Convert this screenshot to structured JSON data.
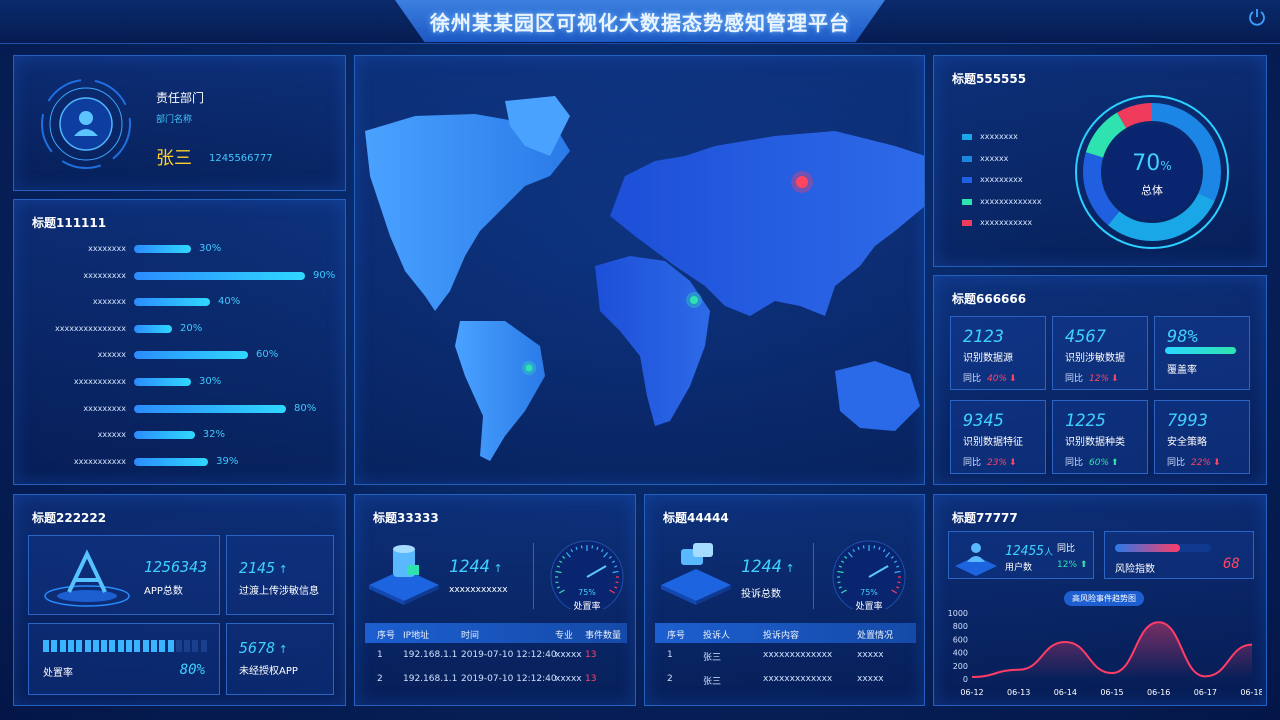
{
  "header": {
    "title": "徐州某某园区可视化大数据态势感知管理平台"
  },
  "user": {
    "dept_label": "责任部门",
    "dept_name": "部门名称",
    "name": "张三",
    "phone": "1245566777"
  },
  "panel1": {
    "title": "标题111111",
    "rows": [
      {
        "label": "xxxxxxxx",
        "value": "30%",
        "pct": 30
      },
      {
        "label": "xxxxxxxxx",
        "value": "90%",
        "pct": 90
      },
      {
        "label": "xxxxxxx",
        "value": "40%",
        "pct": 40
      },
      {
        "label": "xxxxxxxxxxxxxxx",
        "value": "20%",
        "pct": 20
      },
      {
        "label": "xxxxxx",
        "value": "60%",
        "pct": 60
      },
      {
        "label": "xxxxxxxxxxx",
        "value": "30%",
        "pct": 30
      },
      {
        "label": "xxxxxxxxx",
        "value": "80%",
        "pct": 80
      },
      {
        "label": "xxxxxx",
        "value": "32%",
        "pct": 32
      },
      {
        "label": "xxxxxxxxxxx",
        "value": "39%",
        "pct": 39
      }
    ]
  },
  "panel5": {
    "title": "标题555555",
    "legend": [
      {
        "label": "xxxxxxxx",
        "color": "#1aa7e8"
      },
      {
        "label": "xxxxxx",
        "color": "#1a86e0"
      },
      {
        "label": "xxxxxxxxx",
        "color": "#1f5fe0"
      },
      {
        "label": "xxxxxxxxxxxxx",
        "color": "#2ee3b0"
      },
      {
        "label": "xxxxxxxxxxx",
        "color": "#ef3b5c"
      }
    ],
    "donut_value": "70",
    "donut_unit": "%",
    "donut_label": "总体"
  },
  "panel6": {
    "title": "标题666666",
    "stats": [
      {
        "num": "2123",
        "label": "识别数据源",
        "cmp_prefix": "同比",
        "cmp": "40%",
        "dir": "down"
      },
      {
        "num": "4567",
        "label": "识别涉敏数据",
        "cmp_prefix": "同比",
        "cmp": "12%",
        "dir": "down"
      },
      {
        "num": "98%",
        "label": "覆盖率",
        "cmp_prefix": "",
        "cmp": "",
        "dir": "bar"
      },
      {
        "num": "9345",
        "label": "识别数据特征",
        "cmp_prefix": "同比",
        "cmp": "23%",
        "dir": "down"
      },
      {
        "num": "1225",
        "label": "识别数据种类",
        "cmp_prefix": "同比",
        "cmp": "60%",
        "dir": "up"
      },
      {
        "num": "7993",
        "label": "安全策略",
        "cmp_prefix": "同比",
        "cmp": "22%",
        "dir": "down"
      }
    ]
  },
  "panel2": {
    "title": "标题222222",
    "app_total": "1256343",
    "app_total_label": "APP总数",
    "transfer": "2145",
    "transfer_label": "过渡上传涉敏信息",
    "rate_label": "处置率",
    "rate": "80%",
    "rate_pct": 80,
    "unauth": "5678",
    "unauth_label": "未经授权APP"
  },
  "panel3": {
    "title": "标题33333",
    "num": "1244",
    "num_label": "xxxxxxxxxxx",
    "gauge_value": "75%",
    "gauge_pct": 75,
    "gauge_label": "处置率",
    "headers": [
      "序号",
      "IP地址",
      "时间",
      "专业",
      "事件数量"
    ],
    "rows": [
      [
        "1",
        "192.168.1.1",
        "2019-07-10 12:12:40",
        "xxxxx",
        "13"
      ],
      [
        "2",
        "192.168.1.1",
        "2019-07-10 12:12:40",
        "xxxxx",
        "13"
      ]
    ]
  },
  "panel4": {
    "title": "标题44444",
    "num": "1244",
    "num_label": "投诉总数",
    "gauge_value": "75%",
    "gauge_pct": 75,
    "gauge_label": "处置率",
    "headers": [
      "序号",
      "投诉人",
      "投诉内容",
      "处置情况"
    ],
    "rows": [
      [
        "1",
        "张三",
        "xxxxxxxxxxxxx",
        "xxxxx"
      ],
      [
        "2",
        "张三",
        "xxxxxxxxxxxxx",
        "xxxxx"
      ]
    ]
  },
  "panel7": {
    "title": "标题77777",
    "users": "12455",
    "users_unit": "人",
    "users_label": "用户数",
    "cmp_prefix": "同比",
    "cmp": "12%",
    "risk_label": "风险指数",
    "risk": "68",
    "risk_pct": 68,
    "chart_title": "高风险事件趋势图"
  },
  "chart_data": {
    "type": "area",
    "title": "高风险事件趋势图",
    "categories": [
      "06-12",
      "06-13",
      "06-14",
      "06-15",
      "06-16",
      "06-17",
      "06-18"
    ],
    "yticks": [
      "1000",
      "800",
      "600",
      "400",
      "200",
      "0"
    ],
    "ylim": [
      0,
      1000
    ],
    "series": [
      {
        "values": [
          30,
          140,
          560,
          90,
          860,
          40,
          520
        ]
      }
    ],
    "color": "#ff3c68"
  }
}
